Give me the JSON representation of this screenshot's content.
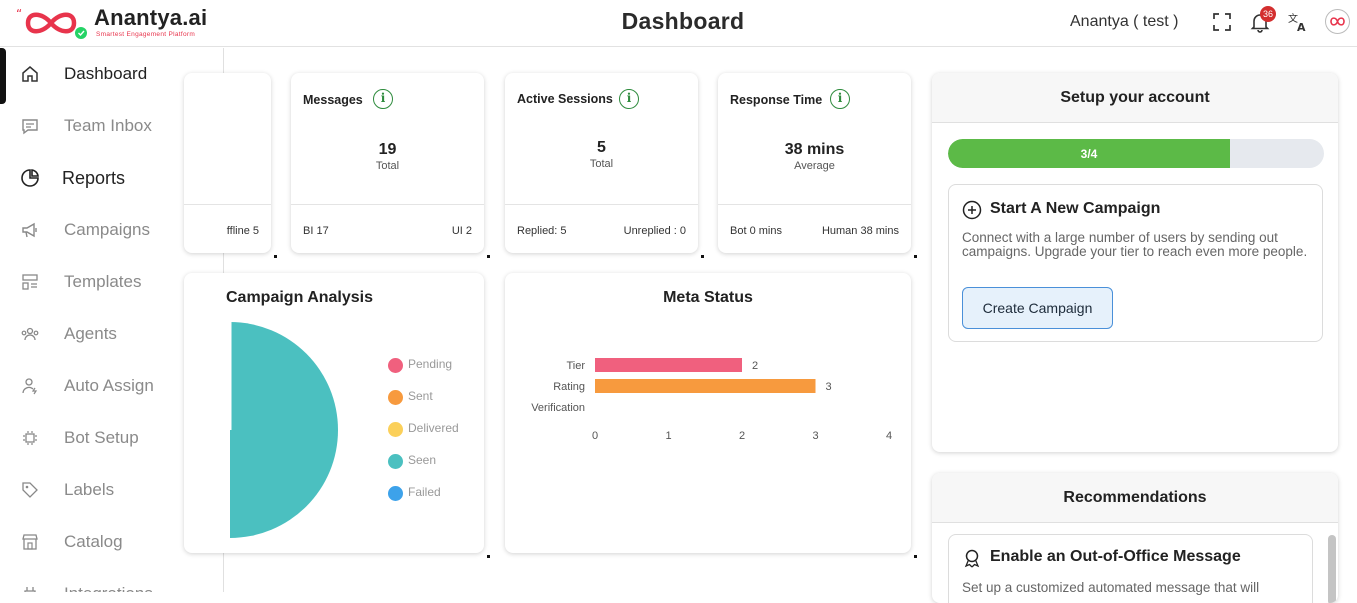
{
  "brand": {
    "name": "Anantya.ai",
    "tagline": "Smartest Engagement Platform"
  },
  "header": {
    "title": "Dashboard",
    "user": "Anantya ( test )",
    "notification_count": "36"
  },
  "sidebar": {
    "items": [
      {
        "label": "Dashboard",
        "icon": "home-icon"
      },
      {
        "label": "Team Inbox",
        "icon": "chat-icon"
      },
      {
        "label": "Reports",
        "icon": "pie-chart-icon"
      },
      {
        "label": "Campaigns",
        "icon": "megaphone-icon"
      },
      {
        "label": "Templates",
        "icon": "template-icon"
      },
      {
        "label": "Agents",
        "icon": "agents-icon"
      },
      {
        "label": "Auto Assign",
        "icon": "user-assign-icon"
      },
      {
        "label": "Bot Setup",
        "icon": "bot-icon"
      },
      {
        "label": "Labels",
        "icon": "tag-icon"
      },
      {
        "label": "Catalog",
        "icon": "store-icon"
      },
      {
        "label": "Integrations",
        "icon": "plug-icon"
      }
    ]
  },
  "stats": {
    "partial": {
      "right_text": "ffline 5"
    },
    "messages": {
      "title": "Messages",
      "value": "19",
      "sub": "Total",
      "left": "BI 17",
      "right": "UI 2"
    },
    "sessions": {
      "title": "Active Sessions",
      "value": "5",
      "sub": "Total",
      "left": "Replied: 5",
      "right": "Unreplied : 0"
    },
    "response": {
      "title": "Response Time",
      "value": "38 mins",
      "sub": "Average",
      "left": "Bot 0 mins",
      "right": "Human 38 mins"
    }
  },
  "campaign_analysis": {
    "title": "Campaign Analysis",
    "legend": [
      {
        "label": "Pending",
        "color": "#f0607e"
      },
      {
        "label": "Sent",
        "color": "#f79a3e"
      },
      {
        "label": "Delivered",
        "color": "#fbd05a"
      },
      {
        "label": "Seen",
        "color": "#4bc0c0"
      },
      {
        "label": "Failed",
        "color": "#3da2ea"
      }
    ]
  },
  "chart_data": {
    "type": "bar",
    "orientation": "horizontal",
    "title": "Meta Status",
    "categories": [
      "Tier",
      "Rating",
      "Verification"
    ],
    "values": [
      2,
      3,
      null
    ],
    "colors": [
      "#f0607e",
      "#f79a3e",
      "#fbd05a"
    ],
    "xlim": [
      0,
      4
    ],
    "xticks": [
      0,
      1,
      2,
      3,
      4
    ],
    "grid": false
  },
  "setup": {
    "title": "Setup your account",
    "progress_label": "3/4",
    "progress_fraction": 0.75,
    "card_title": "Start A New Campaign",
    "card_text": "Connect with a large number of users by sending out campaigns. Upgrade your tier to reach even more people.",
    "button": "Create Campaign"
  },
  "recommendations": {
    "title": "Recommendations",
    "item_title": "Enable an Out-of-Office Message",
    "item_text": "Set up a customized automated message that will"
  }
}
